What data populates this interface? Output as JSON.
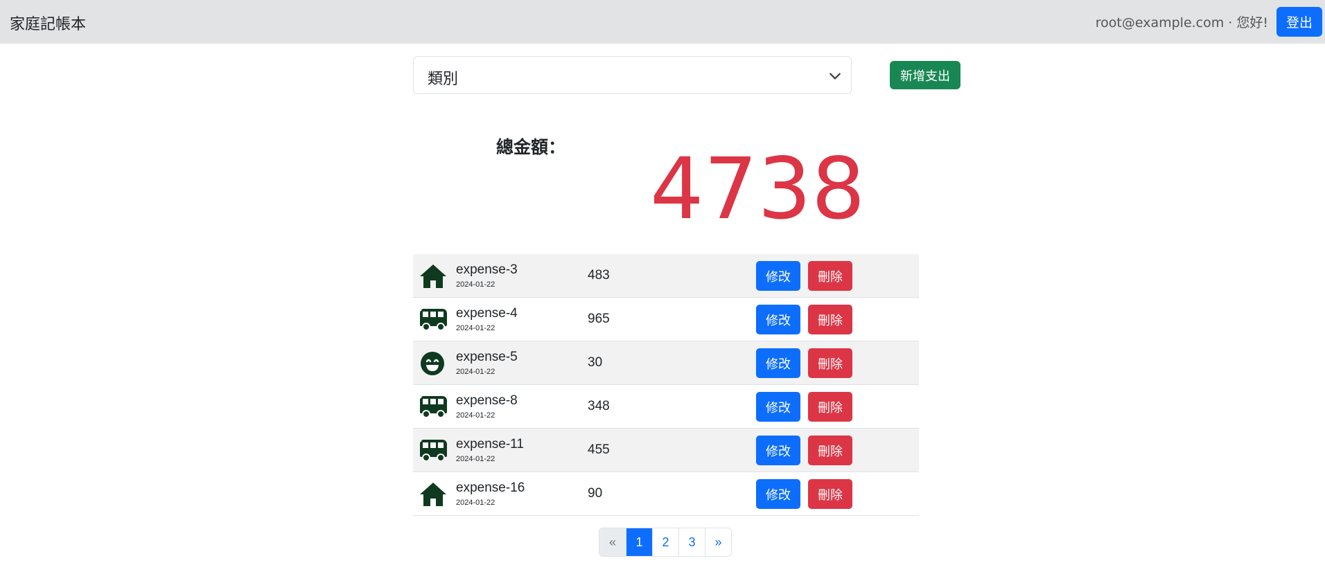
{
  "navbar": {
    "brand": "家庭記帳本",
    "greeting": "root@example.com · 您好!",
    "logout_label": "登出"
  },
  "filter": {
    "selected": "類別"
  },
  "add_button_label": "新增支出",
  "summary": {
    "label": "總金額：",
    "total": "4738"
  },
  "expenses": [
    {
      "icon": "house-icon",
      "name": "expense-3",
      "date": "2024-01-22",
      "amount": "483",
      "edit_label": "修改",
      "delete_label": "刪除"
    },
    {
      "icon": "bus-icon",
      "name": "expense-4",
      "date": "2024-01-22",
      "amount": "965",
      "edit_label": "修改",
      "delete_label": "刪除"
    },
    {
      "icon": "smile-icon",
      "name": "expense-5",
      "date": "2024-01-22",
      "amount": "30",
      "edit_label": "修改",
      "delete_label": "刪除"
    },
    {
      "icon": "bus-icon",
      "name": "expense-8",
      "date": "2024-01-22",
      "amount": "348",
      "edit_label": "修改",
      "delete_label": "刪除"
    },
    {
      "icon": "bus-icon",
      "name": "expense-11",
      "date": "2024-01-22",
      "amount": "455",
      "edit_label": "修改",
      "delete_label": "刪除"
    },
    {
      "icon": "house-icon",
      "name": "expense-16",
      "date": "2024-01-22",
      "amount": "90",
      "edit_label": "修改",
      "delete_label": "刪除"
    }
  ],
  "pagination": {
    "prev": "«",
    "pages": [
      "1",
      "2",
      "3"
    ],
    "current": "1",
    "next": "»"
  },
  "colors": {
    "navbar_bg": "#e2e3e5",
    "primary": "#0d6efd",
    "success": "#198754",
    "danger": "#dc3545",
    "icon": "#0f3a1f"
  }
}
